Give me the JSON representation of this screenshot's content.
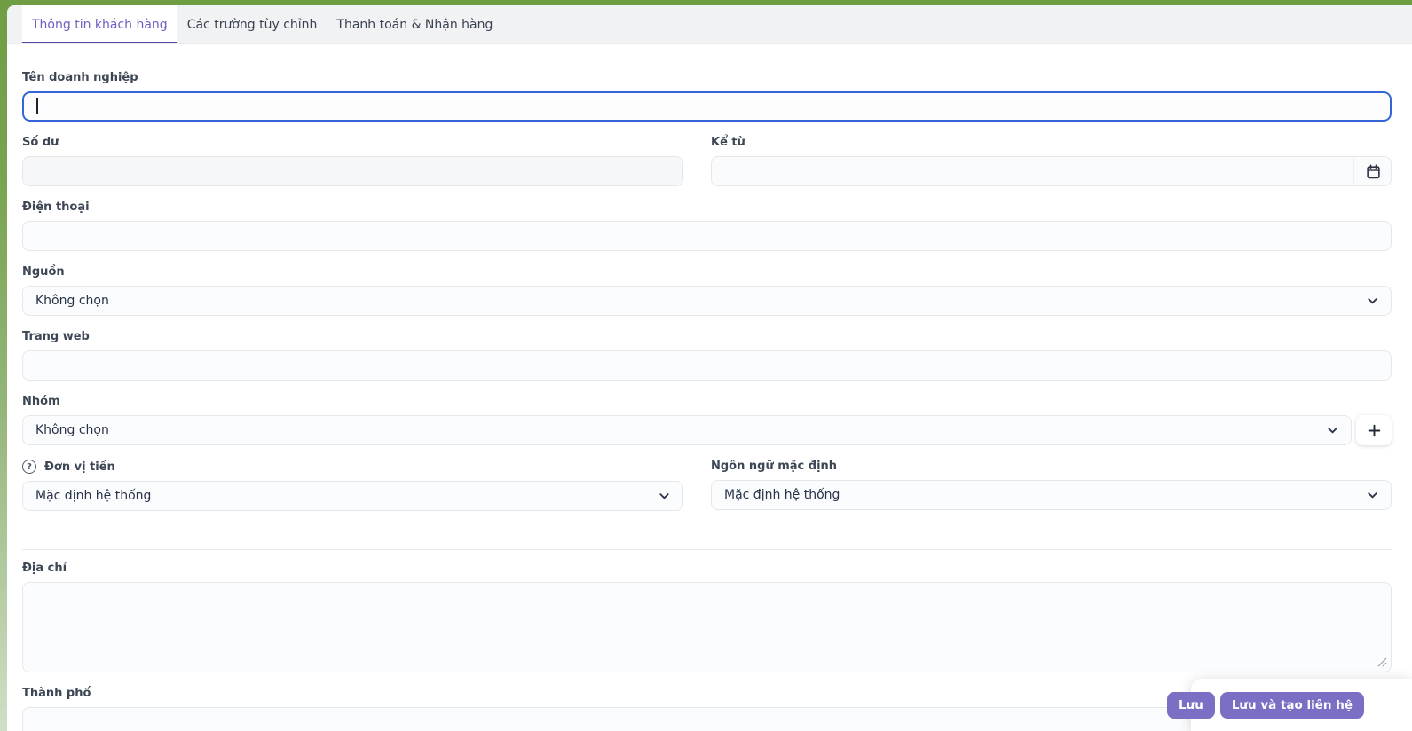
{
  "tabs": {
    "customer_info": "Thông tin khách hàng",
    "custom_fields": "Các trường tùy chỉnh",
    "billing_shipping": "Thanh toán & Nhận hàng"
  },
  "fields": {
    "company": {
      "label": "Tên doanh nghiệp",
      "value": "",
      "placeholder": "",
      "focused": true
    },
    "balance": {
      "label": "Số dư",
      "value": "",
      "placeholder": ""
    },
    "since": {
      "label": "Kể từ",
      "value": "",
      "placeholder": ""
    },
    "phone": {
      "label": "Điện thoại",
      "value": "",
      "placeholder": ""
    },
    "source": {
      "label": "Nguồn",
      "selected": "Không chọn"
    },
    "website": {
      "label": "Trang web",
      "value": "",
      "placeholder": ""
    },
    "groups": {
      "label": "Nhóm",
      "selected": "Không chọn"
    },
    "currency": {
      "label": "Đơn vị tiền",
      "selected": "Mặc định hệ thống"
    },
    "language": {
      "label": "Ngôn ngữ mặc định",
      "selected": "Mặc định hệ thống"
    },
    "address": {
      "label": "Địa chỉ",
      "value": "",
      "placeholder": ""
    },
    "city": {
      "label": "Thành phố",
      "value": "",
      "placeholder": ""
    }
  },
  "actions": {
    "save": "Lưu",
    "save_and_create_contact": "Lưu và tạo liên hệ"
  },
  "icons": {
    "help_glyph": "?"
  },
  "colors": {
    "frame_green": "#6f9d43",
    "tabbar_bg": "#f0f2f4",
    "active_tab_text": "#695fc4",
    "active_tab_underline": "#564aa3",
    "focus_border_blue": "#3566d6",
    "button_purple": "#7a6fc4",
    "label_text": "#3d4654"
  }
}
